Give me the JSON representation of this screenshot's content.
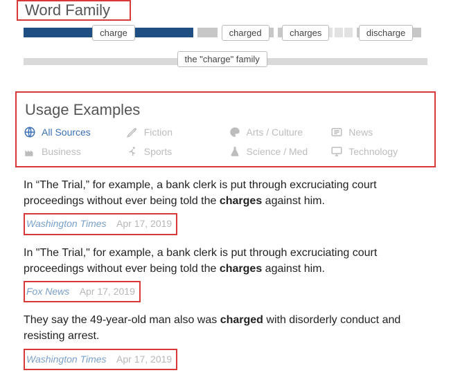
{
  "word_family": {
    "title": "Word Family",
    "chips": [
      "charge",
      "charged",
      "charges",
      "discharge"
    ],
    "family_label": "the \"charge\" family"
  },
  "usage": {
    "title": "Usage Examples",
    "sources": [
      {
        "id": "all",
        "label": "All Sources",
        "icon": "globe-icon",
        "active": true
      },
      {
        "id": "fiction",
        "label": "Fiction",
        "icon": "pencil-icon",
        "active": false
      },
      {
        "id": "arts",
        "label": "Arts / Culture",
        "icon": "palette-icon",
        "active": false
      },
      {
        "id": "news",
        "label": "News",
        "icon": "news-icon",
        "active": false
      },
      {
        "id": "business",
        "label": "Business",
        "icon": "factory-icon",
        "active": false
      },
      {
        "id": "sports",
        "label": "Sports",
        "icon": "runner-icon",
        "active": false
      },
      {
        "id": "science",
        "label": "Science / Med",
        "icon": "flask-icon",
        "active": false
      },
      {
        "id": "tech",
        "label": "Technology",
        "icon": "monitor-icon",
        "active": false
      }
    ]
  },
  "examples": [
    {
      "before": "In “The Trial,” for example, a bank clerk is put through excruciating court proceedings without ever being told the ",
      "bold": "charges",
      "after": " against him.",
      "source": "Washington Times",
      "date": "Apr 17, 2019"
    },
    {
      "before": "In \"The Trial,\" for example, a bank clerk is put through excruciating court proceedings without ever being told the ",
      "bold": "charges",
      "after": " against him.",
      "source": "Fox News",
      "date": "Apr 17, 2019"
    },
    {
      "before": "They say the 49-year-old man also was ",
      "bold": "charged",
      "after": " with disorderly conduct and resisting arrest.",
      "source": "Washington Times",
      "date": "Apr 17, 2019"
    }
  ]
}
